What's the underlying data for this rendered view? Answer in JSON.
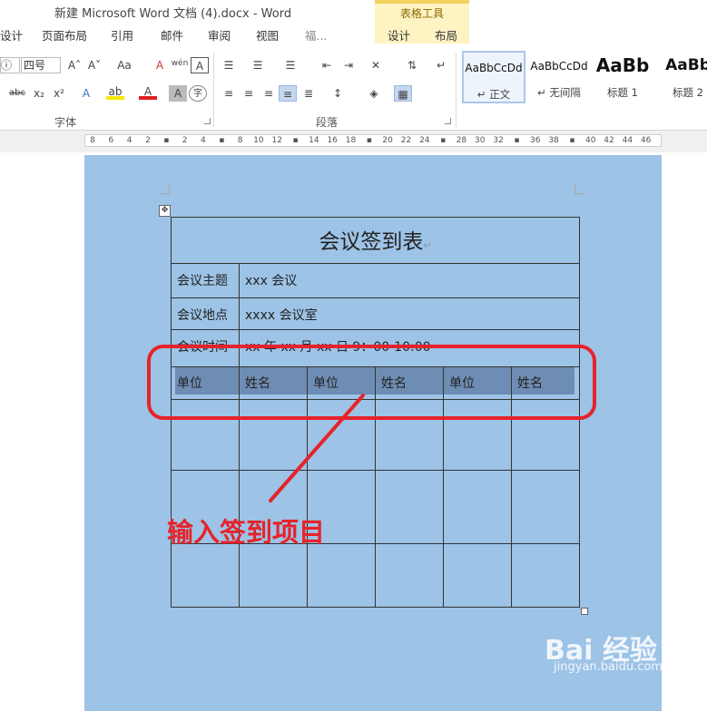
{
  "title_bar": {
    "doc_title": "新建 Microsoft Word 文档 (4).docx - Word"
  },
  "context_tab_group": {
    "label": "表格工具"
  },
  "tabs": [
    {
      "label": "设计"
    },
    {
      "label": "页面布局"
    },
    {
      "label": "引用"
    },
    {
      "label": "邮件"
    },
    {
      "label": "审阅"
    },
    {
      "label": "视图"
    },
    {
      "label": "福...",
      "name": "truncated-tab"
    },
    {
      "label": "设计"
    },
    {
      "label": "布局"
    }
  ],
  "font_group": {
    "font_name": "ⓘ",
    "font_size": "四号",
    "label": "字体",
    "grow": "A˄",
    "shrink": "A˅",
    "change_case": "Aa",
    "clear_format": "A",
    "phonetic": "wén",
    "char_border": "A",
    "strikethrough": "abc",
    "subscript": "x₂",
    "superscript": "x²",
    "text_effect": "A",
    "highlight": "ab",
    "font_color": "A",
    "char_shading": "A",
    "enclose": "字"
  },
  "paragraph_group": {
    "label": "段落"
  },
  "styles": [
    {
      "sample": "AaBbCcDd",
      "name": "↵ 正文",
      "active": true
    },
    {
      "sample": "AaBbCcDd",
      "name": "↵ 无间隔",
      "active": false
    },
    {
      "sample": "AaBb",
      "name": "标题 1",
      "active": false
    },
    {
      "sample": "AaBb",
      "name": "标题 2",
      "active": false
    }
  ],
  "ruler_ticks": [
    "8",
    "6",
    "4",
    "2",
    "",
    "2",
    "4",
    "",
    "8",
    "10",
    "12",
    "",
    "14",
    "16",
    "18",
    "",
    "20",
    "22",
    "24",
    "",
    "28",
    "30",
    "32",
    "",
    "36",
    "38",
    "",
    "40",
    "42",
    "44",
    "46"
  ],
  "document_table": {
    "title": "会议签到表",
    "rows": [
      {
        "label": "会议主题",
        "value": "xxx 会议"
      },
      {
        "label": "会议地点",
        "value": "xxxx 会议室"
      },
      {
        "label": "会议时间",
        "value": "xx 年 xx 月 xx 日      9：00-10:00"
      }
    ],
    "headers": [
      "单位",
      "姓名",
      "单位",
      "姓名",
      "单位",
      "姓名"
    ]
  },
  "annotation": {
    "text": "输入签到项目",
    "color": "#e6232a"
  },
  "watermark": {
    "brand": "Bai 经验",
    "url": "jingyan.baidu.com"
  },
  "colors": {
    "page_bg": "#9dc3e6",
    "header_shade": "#6e8db4",
    "context_tab": "#fdf3c3"
  }
}
